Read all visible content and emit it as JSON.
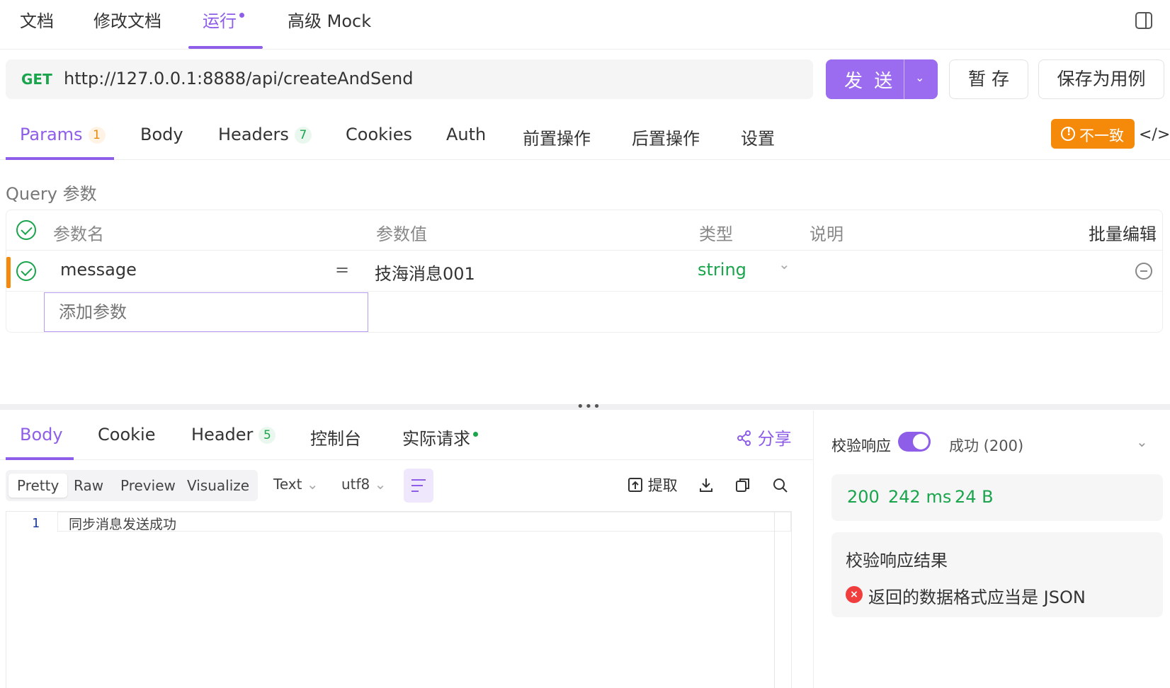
{
  "top_tabs": [
    {
      "label": "文档"
    },
    {
      "label": "修改文档"
    },
    {
      "label": "运行"
    },
    {
      "label": "高级 Mock"
    }
  ],
  "request": {
    "method": "GET",
    "url": "http://127.0.0.1:8888/api/createAndSend",
    "send_label": "发 送",
    "save_temp_label": "暂 存",
    "save_example_label": "保存为用例"
  },
  "req_tabs": [
    {
      "label": "Params",
      "badge": "1"
    },
    {
      "label": "Body"
    },
    {
      "label": "Headers",
      "badge": "7"
    },
    {
      "label": "Cookies"
    },
    {
      "label": "Auth"
    },
    {
      "label": "前置操作"
    },
    {
      "label": "后置操作"
    },
    {
      "label": "设置"
    }
  ],
  "inconsistent_label": "不一致",
  "query": {
    "title": "Query 参数",
    "headers": {
      "name": "参数名",
      "value": "参数值",
      "type": "类型",
      "desc": "说明",
      "bulk": "批量编辑"
    },
    "rows": [
      {
        "name": "message",
        "eq": "=",
        "value": "技海消息001",
        "type": "string"
      }
    ],
    "add_placeholder": "添加参数"
  },
  "response": {
    "tabs": [
      {
        "label": "Body"
      },
      {
        "label": "Cookie"
      },
      {
        "label": "Header",
        "badge": "5"
      },
      {
        "label": "控制台"
      },
      {
        "label": "实际请求"
      }
    ],
    "share_label": "分享",
    "formats": [
      "Pretty",
      "Raw",
      "Preview",
      "Visualize"
    ],
    "text_dropdown": "Text",
    "encoding_dropdown": "utf8",
    "extract_label": "提取",
    "line_number": "1",
    "body_text": "同步消息发送成功"
  },
  "validation": {
    "label": "校验响应",
    "enabled": true,
    "status": "成功 (200)",
    "code": "200",
    "time": "242 ms",
    "size": "24 B",
    "result_title": "校验响应结果",
    "error": "返回的数据格式应当是 JSON"
  },
  "colors": {
    "accent": "#8e5ee8",
    "success": "#1aa44c",
    "warning": "#f58a0a",
    "error": "#f03e3e"
  }
}
